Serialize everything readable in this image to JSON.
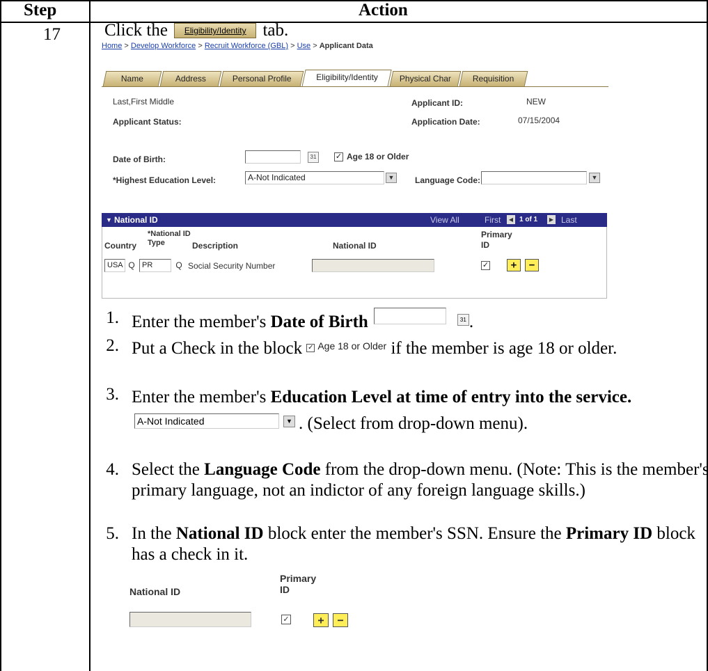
{
  "table": {
    "header_step": "Step",
    "header_action": "Action",
    "step_number": "17"
  },
  "intro": {
    "prefix": "Click the",
    "tab_label": "Eligibility/Identity",
    "suffix": "tab."
  },
  "breadcrumb": {
    "items": [
      "Home",
      "Develop Workforce",
      "Recruit Workforce (GBL)",
      "Use"
    ],
    "separator": ">",
    "current": "Applicant Data"
  },
  "tabs": [
    {
      "label": "Name"
    },
    {
      "label": "Address"
    },
    {
      "label": "Personal Profile"
    },
    {
      "label": "Eligibility/Identity",
      "active": true
    },
    {
      "label": "Physical Char"
    },
    {
      "label": "Requisition"
    }
  ],
  "form": {
    "applicant_name": "Last,First Middle",
    "applicant_status_label": "Applicant Status:",
    "applicant_id_label": "Applicant ID:",
    "applicant_id_value": "NEW",
    "application_date_label": "Application Date:",
    "application_date_value": "07/15/2004",
    "dob_label": "Date of Birth:",
    "age18_label": "Age 18 or Older",
    "age18_checked": true,
    "education_label": "*Highest Education Level:",
    "education_value": "A-Not Indicated",
    "language_label": "Language Code:",
    "language_value": ""
  },
  "national_id_grid": {
    "title": "National ID",
    "view_all": "View All",
    "first": "First",
    "page_info": "1 of 1",
    "last": "Last",
    "col_country": "Country",
    "col_type": "*National ID Type",
    "col_description": "Description",
    "col_national_id": "National ID",
    "col_primary": "Primary ID",
    "row": {
      "country": "USA",
      "type": "PR",
      "description": "Social Security Number",
      "national_id": "",
      "primary": true
    }
  },
  "instructions": [
    {
      "num": "1.",
      "pre": "Enter the member's",
      "bold": "Date of Birth"
    },
    {
      "num": "2.",
      "pre": "Put a Check in the block",
      "chk": "Age 18 or Older",
      "post": "if the member is age 18 or older."
    },
    {
      "num": "3.",
      "pre": "Enter the member's",
      "bold": "Education Level at time of entry into the service.",
      "post": ". (Select from drop-down menu)."
    },
    {
      "num": "4.",
      "pre": "Select the",
      "bold": "Language Code",
      "post": "from the drop-down menu. (Note: This is the member's primary language, not an indictor of any foreign language skills.)"
    },
    {
      "num": "5.",
      "pre": "In the",
      "bold": "National ID",
      "mid": "block enter the member's SSN.  Ensure the",
      "bold2": "Primary ID",
      "post": "block has a check in it."
    }
  ],
  "mini": {
    "national_id_label": "National ID",
    "primary_label": "Primary ID"
  },
  "glyphs": {
    "checkmark": "☑",
    "check": "✓",
    "down": "▼",
    "search": "Q",
    "plus": "+",
    "minus": "−",
    "prev": "◀",
    "next": "▶",
    "cal": "31"
  },
  "colors": {
    "grid_header": "#2a2b86",
    "tab_gold": "#c7b173",
    "button_yellow": "#ffee58",
    "link_blue": "#1a3fa8"
  }
}
